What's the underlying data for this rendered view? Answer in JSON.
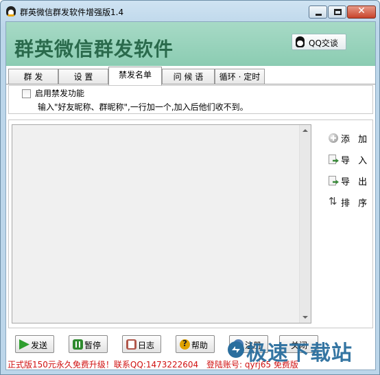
{
  "window": {
    "title": "群英微信群发软件增强版1.4",
    "close_glyph": "✕"
  },
  "banner": {
    "title": "群英微信群发软件",
    "qq_button": "QQ交谈"
  },
  "tabs": [
    {
      "label": "群  发"
    },
    {
      "label": "设  置"
    },
    {
      "label": "禁发名单",
      "active": true
    },
    {
      "label": "问 候 语"
    },
    {
      "label": "循环 · 定时"
    }
  ],
  "blocklist": {
    "enable_label": "启用禁发功能",
    "hint": "输入\"好友昵称、群昵称\",一行加一个,加入后他们收不到。",
    "enabled": false
  },
  "side_buttons": {
    "add": "添 加",
    "import": "导 入",
    "export": "导 出",
    "sort": "排 序"
  },
  "bottom_buttons": {
    "send": "发送",
    "pause": "暂停",
    "log": "日志",
    "help": "帮助",
    "login": "注册",
    "last": "关闭"
  },
  "status": {
    "left": "正式版150元永久免费升级！联系QQ:1473222604",
    "right": "登陆账号: qyrj65   免费版"
  },
  "watermark": "极速下载站"
}
